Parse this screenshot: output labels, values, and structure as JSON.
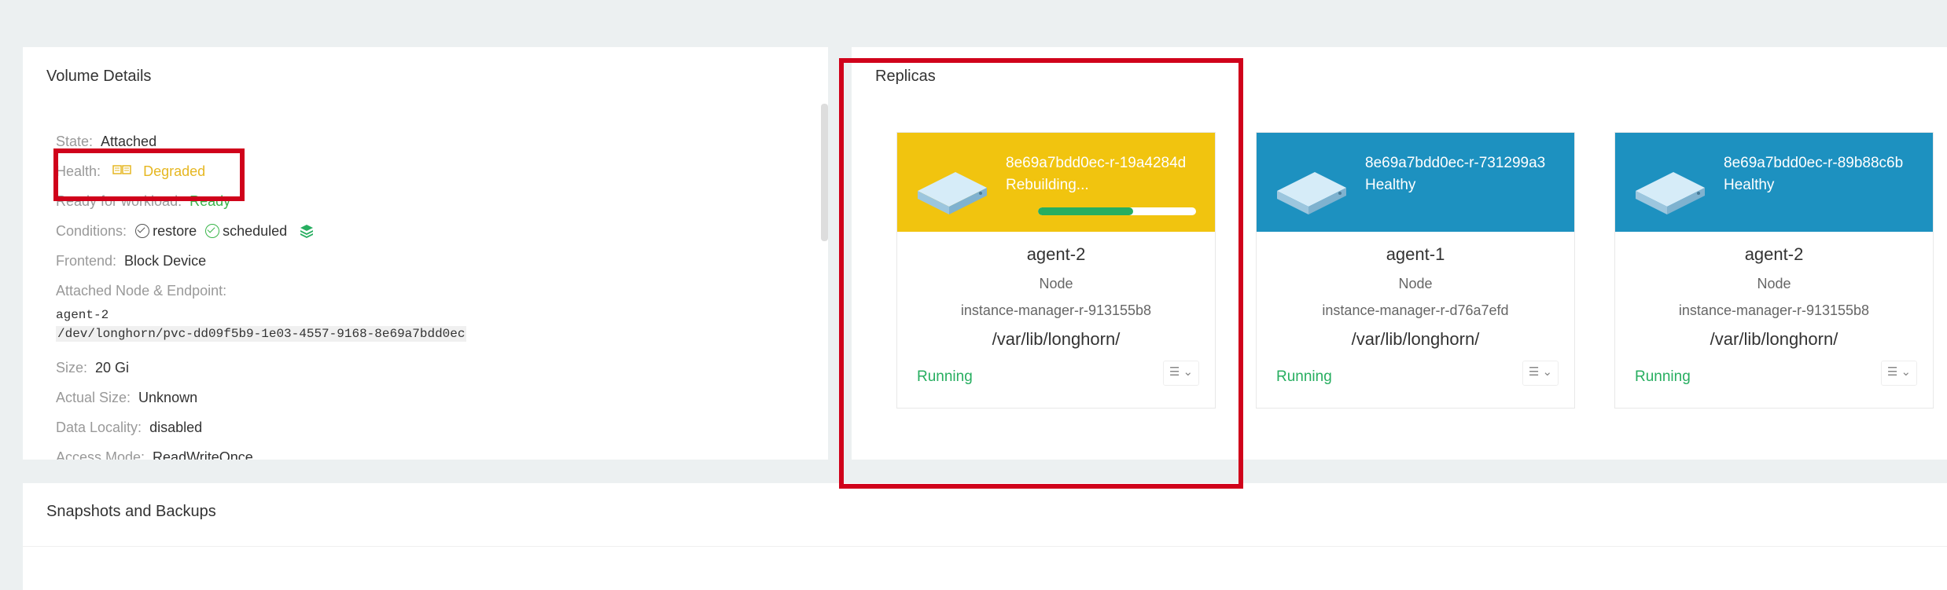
{
  "volume_details": {
    "title": "Volume Details",
    "state_label": "State:",
    "state_value": "Attached",
    "health_label": "Health:",
    "health_value": "Degraded",
    "ready_label": "Ready for workload:",
    "ready_value": "Ready",
    "conditions_label": "Conditions:",
    "condition_restore": "restore",
    "condition_scheduled": "scheduled",
    "frontend_label": "Frontend:",
    "frontend_value": "Block Device",
    "attached_label": "Attached Node & Endpoint:",
    "attached_node": "agent-2",
    "attached_endpoint": "/dev/longhorn/pvc-dd09f5b9-1e03-4557-9168-8e69a7bdd0ec",
    "size_label": "Size:",
    "size_value": "20 Gi",
    "actual_size_label": "Actual Size:",
    "actual_size_value": "Unknown",
    "locality_label": "Data Locality:",
    "locality_value": "disabled",
    "access_label": "Access Mode:",
    "access_value": "ReadWriteOnce"
  },
  "replicas": {
    "title": "Replicas",
    "cards": [
      {
        "name": "8e69a7bdd0ec-r-19a4284d",
        "state": "Rebuilding...",
        "progress": 0.6,
        "node": "agent-2",
        "node_label": "Node",
        "instance_manager": "instance-manager-r-913155b8",
        "path": "/var/lib/longhorn/",
        "status": "Running",
        "color": "#f1c40f"
      },
      {
        "name": "8e69a7bdd0ec-r-731299a3",
        "state": "Healthy",
        "node": "agent-1",
        "node_label": "Node",
        "instance_manager": "instance-manager-r-d76a7efd",
        "path": "/var/lib/longhorn/",
        "status": "Running",
        "color": "#1d91c0"
      },
      {
        "name": "8e69a7bdd0ec-r-89b88c6b",
        "state": "Healthy",
        "node": "agent-2",
        "node_label": "Node",
        "instance_manager": "instance-manager-r-913155b8",
        "path": "/var/lib/longhorn/",
        "status": "Running",
        "color": "#1d91c0"
      }
    ]
  },
  "snapshots": {
    "title": "Snapshots and Backups"
  }
}
